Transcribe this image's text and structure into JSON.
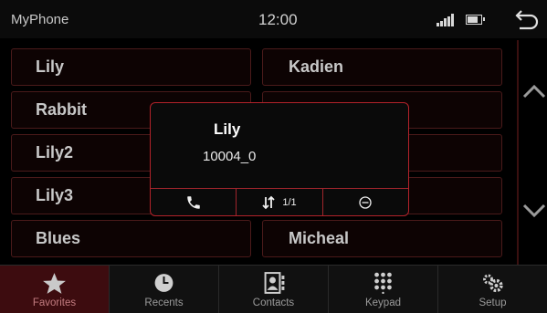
{
  "status_bar": {
    "app_title": "MyPhone",
    "clock": "12:00"
  },
  "contacts": {
    "left": [
      "Lily",
      "Rabbit",
      "Lily2",
      "Lily3",
      "Blues"
    ],
    "right": [
      "Kadien",
      "",
      "",
      "",
      "Micheal"
    ]
  },
  "popup": {
    "name": "Lily",
    "number": "10004_0",
    "page_indicator": "1/1"
  },
  "tabs": [
    {
      "label": "Favorites",
      "icon": "star-icon",
      "active": true
    },
    {
      "label": "Recents",
      "icon": "clock-icon",
      "active": false
    },
    {
      "label": "Contacts",
      "icon": "contacts-book-icon",
      "active": false
    },
    {
      "label": "Keypad",
      "icon": "keypad-icon",
      "active": false
    },
    {
      "label": "Setup",
      "icon": "gears-icon",
      "active": false
    }
  ],
  "colors": {
    "accent": "#b2222a",
    "active_tab_bg": "#3d0c0f"
  }
}
